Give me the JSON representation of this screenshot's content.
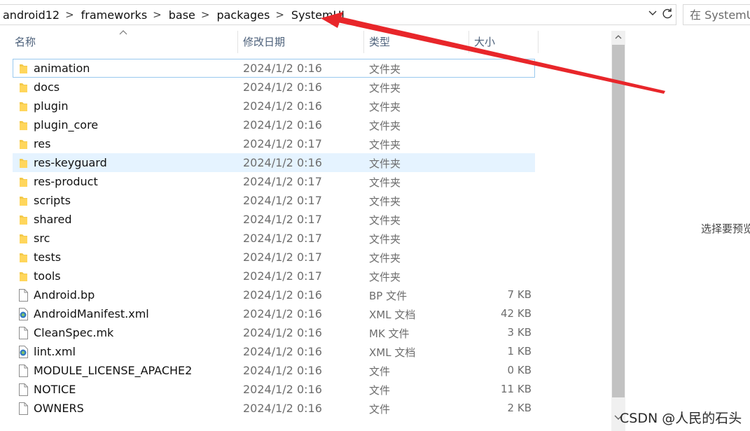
{
  "address_bar": {
    "crumbs": [
      "android12",
      "frameworks",
      "base",
      "packages",
      "SystemUI"
    ],
    "separator": ">"
  },
  "search": {
    "placeholder": "在 SystemUI 中搜索"
  },
  "columns": {
    "name": "名称",
    "date": "修改日期",
    "type": "类型",
    "size": "大小"
  },
  "files": [
    {
      "name": "animation",
      "date": "2024/1/2 0:16",
      "type": "文件夹",
      "size": "",
      "icon": "folder-icon"
    },
    {
      "name": "docs",
      "date": "2024/1/2 0:16",
      "type": "文件夹",
      "size": "",
      "icon": "folder-icon"
    },
    {
      "name": "plugin",
      "date": "2024/1/2 0:16",
      "type": "文件夹",
      "size": "",
      "icon": "folder-icon"
    },
    {
      "name": "plugin_core",
      "date": "2024/1/2 0:16",
      "type": "文件夹",
      "size": "",
      "icon": "folder-icon"
    },
    {
      "name": "res",
      "date": "2024/1/2 0:17",
      "type": "文件夹",
      "size": "",
      "icon": "folder-icon"
    },
    {
      "name": "res-keyguard",
      "date": "2024/1/2 0:16",
      "type": "文件夹",
      "size": "",
      "icon": "folder-icon"
    },
    {
      "name": "res-product",
      "date": "2024/1/2 0:17",
      "type": "文件夹",
      "size": "",
      "icon": "folder-icon"
    },
    {
      "name": "scripts",
      "date": "2024/1/2 0:17",
      "type": "文件夹",
      "size": "",
      "icon": "folder-icon"
    },
    {
      "name": "shared",
      "date": "2024/1/2 0:17",
      "type": "文件夹",
      "size": "",
      "icon": "folder-icon"
    },
    {
      "name": "src",
      "date": "2024/1/2 0:17",
      "type": "文件夹",
      "size": "",
      "icon": "folder-icon"
    },
    {
      "name": "tests",
      "date": "2024/1/2 0:17",
      "type": "文件夹",
      "size": "",
      "icon": "folder-icon"
    },
    {
      "name": "tools",
      "date": "2024/1/2 0:17",
      "type": "文件夹",
      "size": "",
      "icon": "folder-icon"
    },
    {
      "name": "Android.bp",
      "date": "2024/1/2 0:16",
      "type": "BP 文件",
      "size": "7 KB",
      "icon": "file-icon"
    },
    {
      "name": "AndroidManifest.xml",
      "date": "2024/1/2 0:16",
      "type": "XML 文档",
      "size": "42 KB",
      "icon": "xml-file-icon"
    },
    {
      "name": "CleanSpec.mk",
      "date": "2024/1/2 0:16",
      "type": "MK 文件",
      "size": "3 KB",
      "icon": "file-icon"
    },
    {
      "name": "lint.xml",
      "date": "2024/1/2 0:16",
      "type": "XML 文档",
      "size": "1 KB",
      "icon": "xml-file-icon"
    },
    {
      "name": "MODULE_LICENSE_APACHE2",
      "date": "2024/1/2 0:16",
      "type": "文件",
      "size": "0 KB",
      "icon": "file-icon"
    },
    {
      "name": "NOTICE",
      "date": "2024/1/2 0:16",
      "type": "文件",
      "size": "11 KB",
      "icon": "file-icon"
    },
    {
      "name": "OWNERS",
      "date": "2024/1/2 0:16",
      "type": "文件",
      "size": "2 KB",
      "icon": "file-icon"
    }
  ],
  "focused_row": 0,
  "hover_row": 5,
  "preview": {
    "text": "选择要预览"
  },
  "watermark": "CSDN @人民的石头",
  "colors": {
    "folder": "#ffd65c",
    "arrow": "#e8262a",
    "hover_bg": "#e5f3ff",
    "focus_border": "#99c9ef",
    "header_text": "#4c607a"
  }
}
